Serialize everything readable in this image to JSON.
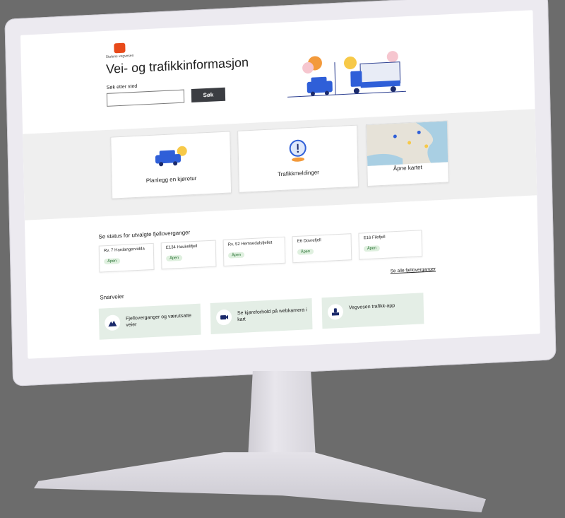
{
  "brand": {
    "logo_text": "Statens vegvesen"
  },
  "header": {
    "title": "Vei- og trafikkinformasjon"
  },
  "search": {
    "label": "Søk etter sted",
    "placeholder": "",
    "value": "",
    "button": "Søk"
  },
  "cards": [
    {
      "label": "Planlegg en kjøretur",
      "icon": "car-icon"
    },
    {
      "label": "Trafikkmeldinger",
      "icon": "alert-pin-icon"
    },
    {
      "label": "Åpne kartet",
      "icon": "map-icon"
    }
  ],
  "mountain_passes": {
    "title": "Se status for utvalgte fjelloverganger",
    "items": [
      {
        "name": "Rv. 7 Hardangervidda",
        "status": "Åpen"
      },
      {
        "name": "E134 Haukelifjell",
        "status": "Åpen"
      },
      {
        "name": "Rv. 52 Hemsedalsfjellet",
        "status": "Åpen"
      },
      {
        "name": "E6 Dovrefjell",
        "status": "Åpen"
      },
      {
        "name": "E16 Filefjell",
        "status": "Åpen"
      }
    ],
    "see_all": "Se alle fjelloverganger"
  },
  "shortcuts": {
    "title": "Snarveier",
    "items": [
      {
        "label": "Fjelloverganger og værutsatte veier",
        "icon": "mountain-icon"
      },
      {
        "label": "Se kjøreforhold på webkamera i kart",
        "icon": "camera-icon"
      },
      {
        "label": "Vegvesen trafikk-app",
        "icon": "phone-app-icon"
      }
    ]
  },
  "colors": {
    "accent": "#3b3d42",
    "brand": "#e84a1a",
    "status_green_bg": "#dff0df",
    "shortcut_bg": "#e4eee6"
  }
}
